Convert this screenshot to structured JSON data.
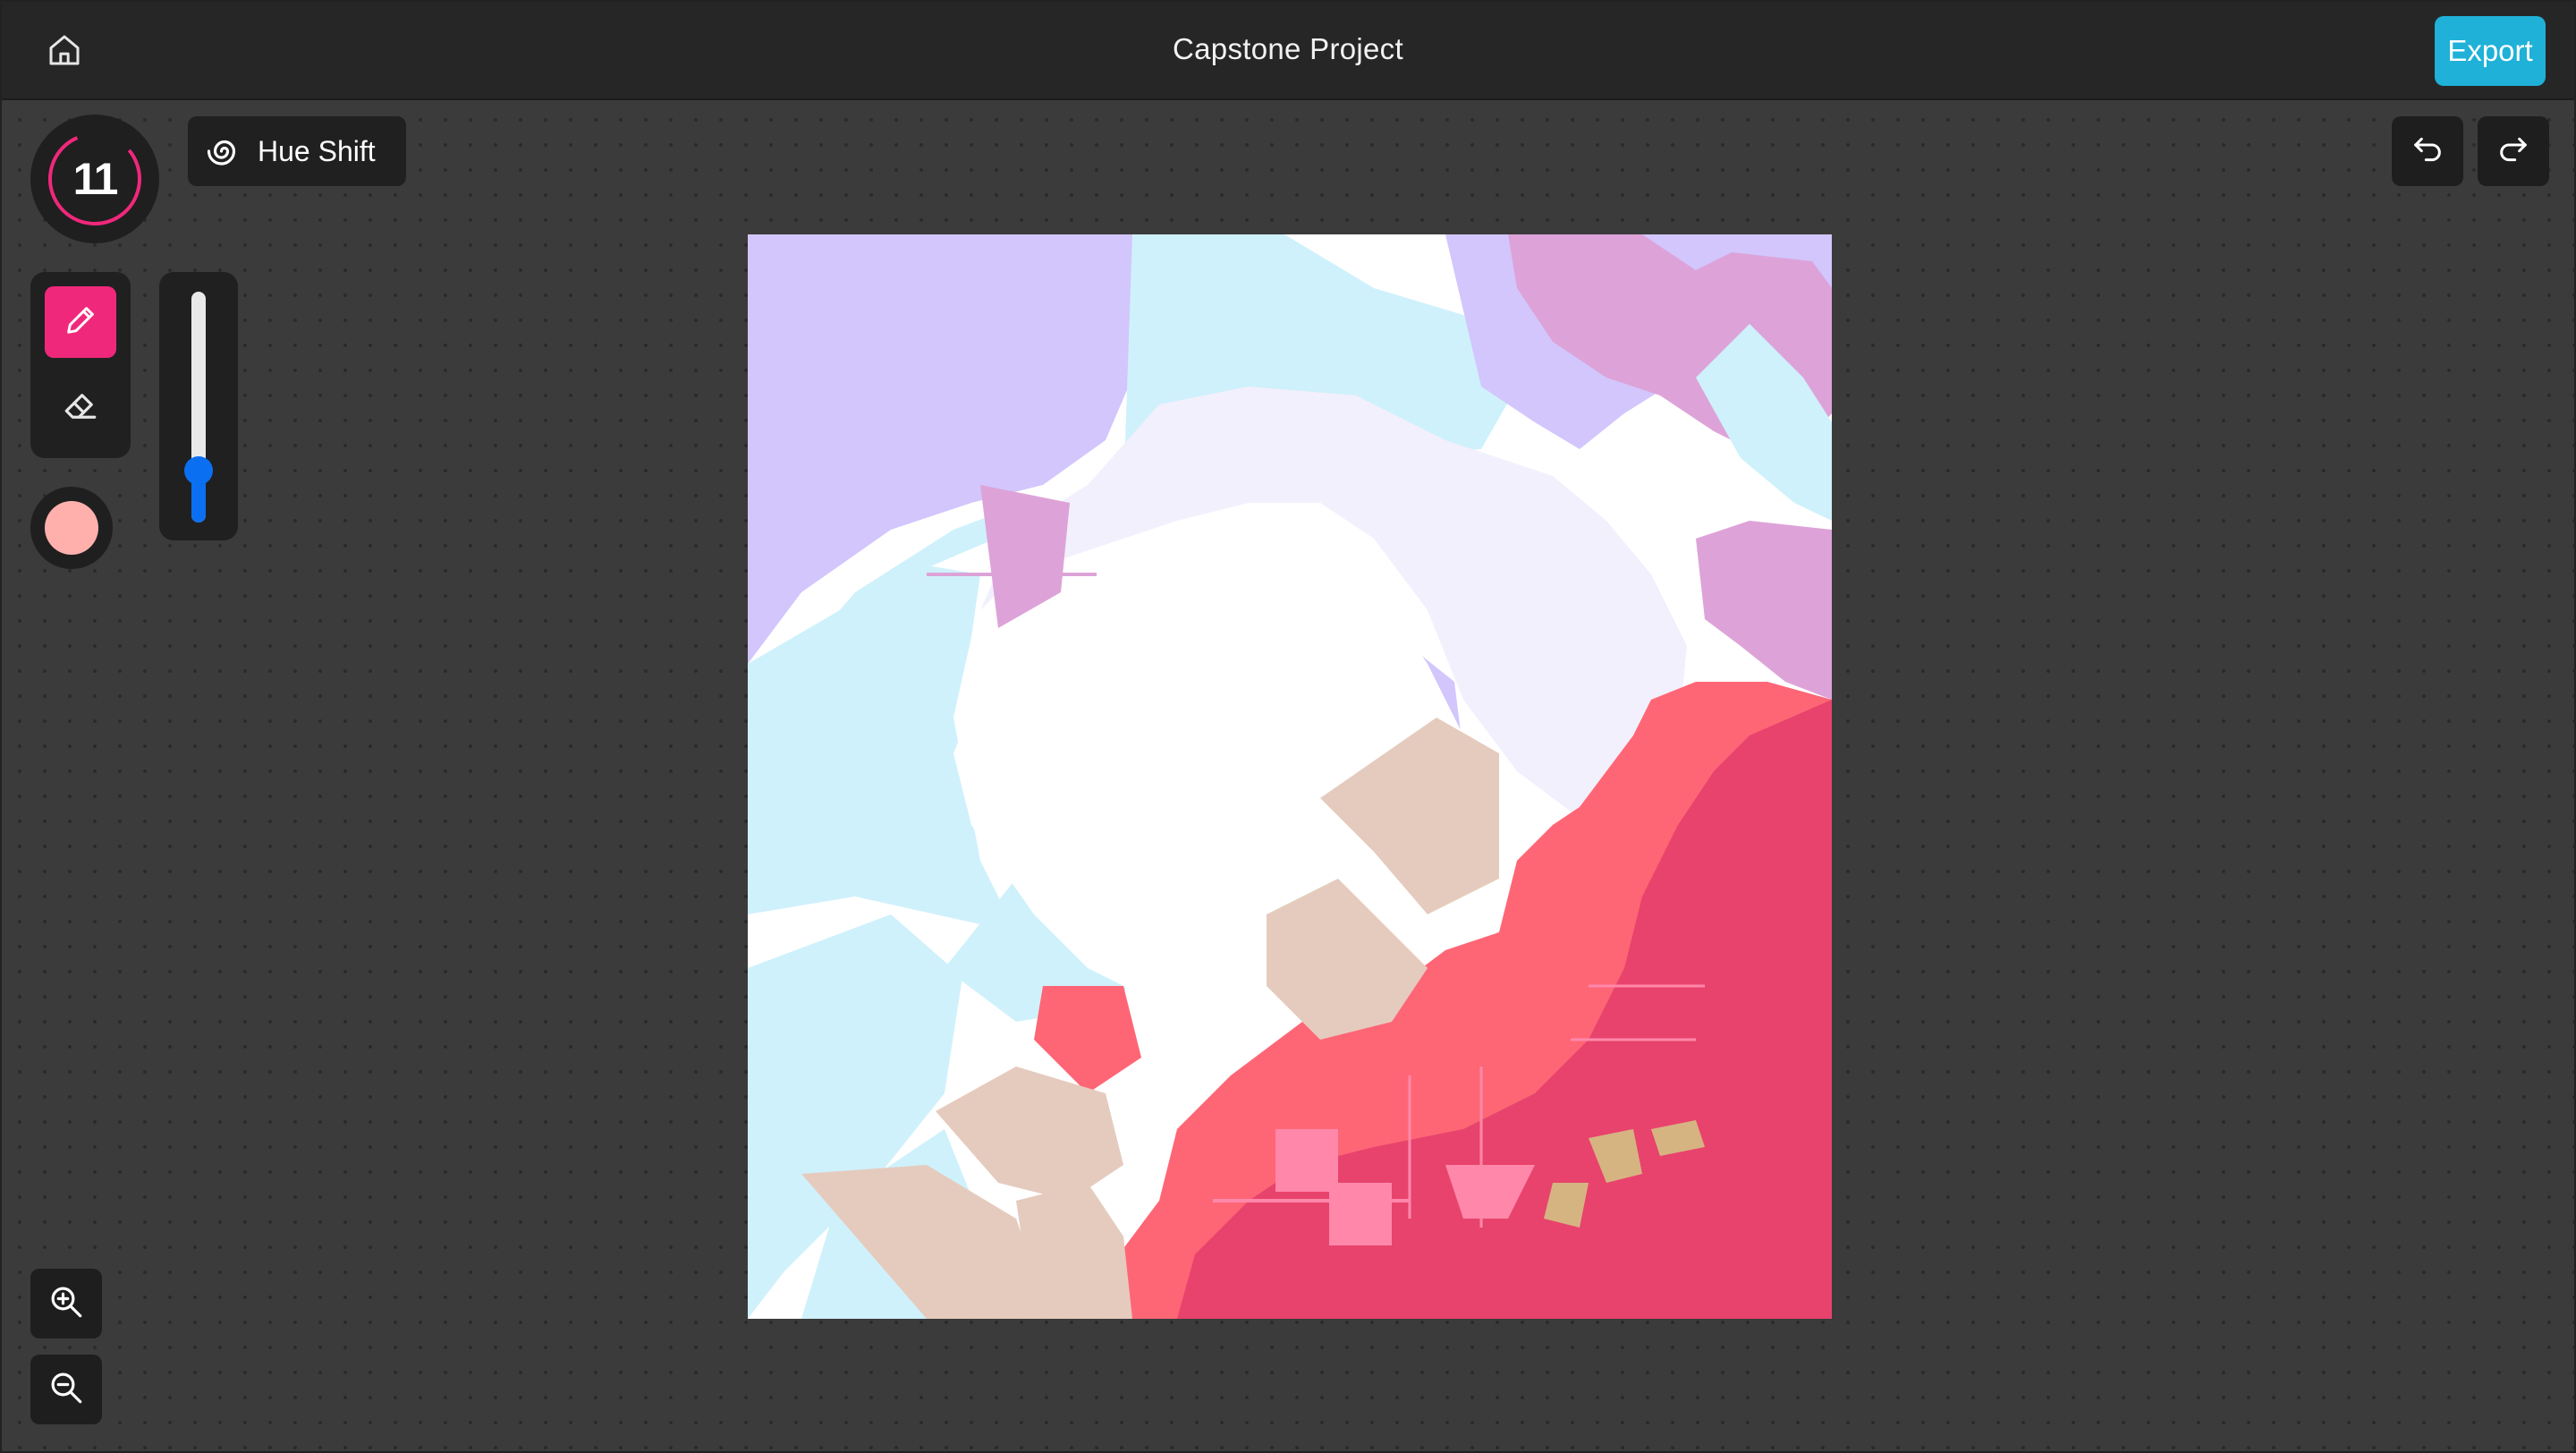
{
  "header": {
    "title": "Capstone Project",
    "export_label": "Export",
    "home_icon": "home-icon"
  },
  "toolbar": {
    "brush_size": "11",
    "hue_shift_label": "Hue Shift",
    "hue_shift_icon": "spiral-icon",
    "tools": [
      {
        "name": "pencil",
        "icon": "pencil-icon",
        "active": true
      },
      {
        "name": "eraser",
        "icon": "eraser-icon",
        "active": false
      }
    ],
    "slider_value": 0.2,
    "brush_color": "#ffb0ad",
    "accent_color": "#f0287b",
    "undo_icon": "undo-icon",
    "redo_icon": "redo-icon",
    "zoom_in_icon": "zoom-in-icon",
    "zoom_out_icon": "zoom-out-icon"
  },
  "palette": {
    "lavender": "#d2c6fc",
    "light_blue": "#cff1fc",
    "pale_lilac": "#f2f0fc",
    "orchid": "#dda3d8",
    "beige": "#e5cbbe",
    "coral": "#fe6676",
    "rose": "#e8436c",
    "pink": "#ff88aa",
    "tan": "#d6b482"
  }
}
